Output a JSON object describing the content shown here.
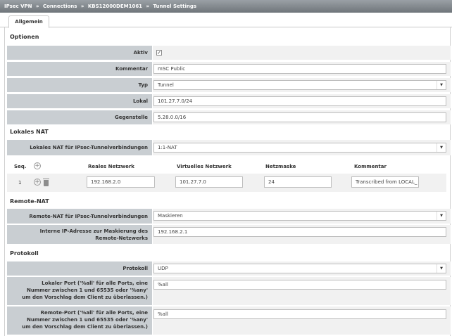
{
  "breadcrumb": {
    "items": [
      "IPsec VPN",
      "Connections",
      "KBS12000DEM1061",
      "Tunnel Settings"
    ],
    "separator": "»"
  },
  "tabs": [
    {
      "label": "Allgemein",
      "active": true
    }
  ],
  "sections": {
    "optionen": "Optionen",
    "lokales_nat": "Lokales NAT",
    "remote_nat": "Remote-NAT",
    "protokoll": "Protokoll"
  },
  "optionen": {
    "aktiv_label": "Aktiv",
    "aktiv_checked": true,
    "aktiv_mark": "✓",
    "kommentar_label": "Kommentar",
    "kommentar_value": "mSC Public",
    "typ_label": "Typ",
    "typ_value": "Tunnel",
    "lokal_label": "Lokal",
    "lokal_value": "101.27.7.0/24",
    "gegenstelle_label": "Gegenstelle",
    "gegenstelle_value": "5.28.0.0/16"
  },
  "lokales_nat": {
    "label": "Lokales NAT für IPsec-Tunnelverbindungen",
    "value": "1:1-NAT",
    "table": {
      "headers": [
        "Seq.",
        "Reales Netzwerk",
        "Virtuelles Netzwerk",
        "Netzmaske",
        "Kommentar"
      ],
      "rows": [
        {
          "seq": "1",
          "reales": "192.168.2.0",
          "virtuelles": "101.27.7.0",
          "netzmaske": "24",
          "kommentar": "Transcribed from LOCAL_"
        }
      ]
    }
  },
  "remote_nat": {
    "label": "Remote-NAT für IPsec-Tunnelverbindungen",
    "value": "Maskieren",
    "interne_label": "Interne IP-Adresse zur Maskierung des Remote-Netzwerks",
    "interne_value": "192.168.2.1"
  },
  "protokoll": {
    "protokoll_label": "Protokoll",
    "protokoll_value": "UDP",
    "lokaler_port_label": "Lokaler Port ('%all' für alle Ports, eine Nummer zwischen 1 und 65535 oder '%any' um den Vorschlag dem Client zu überlassen.)",
    "lokaler_port_value": "%all",
    "remote_port_label": "Remote-Port ('%all' für alle Ports, eine Nummer zwischen 1 und 65535 oder '%any' um den Vorschlag dem Client zu überlassen.)",
    "remote_port_value": "%all"
  },
  "icons": {
    "dropdown": "▼",
    "add": "+"
  }
}
